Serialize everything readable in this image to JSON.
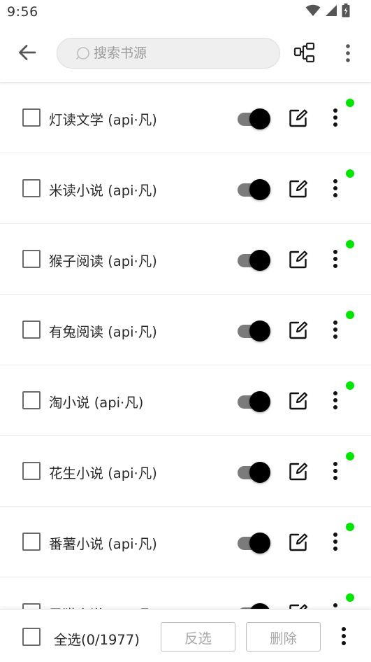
{
  "status_bar": {
    "time": "9:56",
    "icons": [
      "wifi-icon",
      "cell-signal-icon",
      "battery-charging-icon"
    ]
  },
  "toolbar": {
    "back_icon": "arrow-left-icon",
    "search_placeholder": "搜索书源",
    "search_value": "",
    "group_icon": "group-icon",
    "more_icon": "more-vertical-icon"
  },
  "sources": [
    {
      "name": "灯读文学 (api·凡)",
      "enabled": true,
      "checked": false,
      "status_color": "#00e600"
    },
    {
      "name": "米读小说 (api·凡)",
      "enabled": true,
      "checked": false,
      "status_color": "#00e600"
    },
    {
      "name": "猴子阅读 (api·凡)",
      "enabled": true,
      "checked": false,
      "status_color": "#00e600"
    },
    {
      "name": "有兔阅读 (api·凡)",
      "enabled": true,
      "checked": false,
      "status_color": "#00e600"
    },
    {
      "name": "淘小说 (api·凡)",
      "enabled": true,
      "checked": false,
      "status_color": "#00e600"
    },
    {
      "name": "花生小说 (api·凡)",
      "enabled": true,
      "checked": false,
      "status_color": "#00e600"
    },
    {
      "name": "番薯小说 (api·凡)",
      "enabled": true,
      "checked": false,
      "status_color": "#00e600"
    },
    {
      "name": "灵猫小说 (api·凡)",
      "enabled": true,
      "checked": false,
      "status_color": "#00e600"
    }
  ],
  "bottom_bar": {
    "select_all_label": "全选(0/1977)",
    "invert_label": "反选",
    "delete_label": "删除",
    "more_icon": "more-vertical-icon"
  },
  "colors": {
    "accent": "#000000",
    "switch_track": "#7b7b7b",
    "status_ok": "#00e600",
    "disabled_text": "#a8a8a8"
  }
}
